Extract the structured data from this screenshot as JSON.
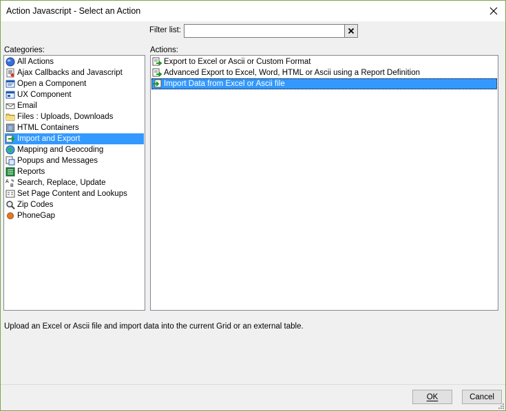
{
  "window": {
    "title": "Action Javascript - Select an Action",
    "close_icon": "close-icon"
  },
  "filter": {
    "label": "Filter list:",
    "value": "",
    "clear_icon": "clear-x-icon"
  },
  "categories": {
    "label": "Categories:",
    "selected_index": 7,
    "items": [
      {
        "label": "All Actions",
        "icon": "globe-blue-icon"
      },
      {
        "label": "Ajax Callbacks and Javascript",
        "icon": "script-icon"
      },
      {
        "label": "Open a Component",
        "icon": "component-window-icon"
      },
      {
        "label": "UX Component",
        "icon": "ux-window-icon"
      },
      {
        "label": "Email",
        "icon": "email-icon"
      },
      {
        "label": "Files : Uploads, Downloads",
        "icon": "folder-icon"
      },
      {
        "label": "HTML Containers",
        "icon": "html-container-icon"
      },
      {
        "label": "Import and Export",
        "icon": "import-export-icon"
      },
      {
        "label": "Mapping and Geocoding",
        "icon": "earth-icon"
      },
      {
        "label": "Popups and Messages",
        "icon": "popup-icon"
      },
      {
        "label": "Reports",
        "icon": "report-icon"
      },
      {
        "label": "Search, Replace, Update",
        "icon": "search-replace-icon"
      },
      {
        "label": "Set Page Content and Lookups",
        "icon": "page-content-icon"
      },
      {
        "label": "Zip Codes",
        "icon": "magnifier-icon"
      },
      {
        "label": "PhoneGap",
        "icon": "phonegap-icon"
      }
    ]
  },
  "actions": {
    "label": "Actions:",
    "selected_index": 2,
    "items": [
      {
        "label": "Export to Excel or Ascii or Custom Format",
        "icon": "export-icon"
      },
      {
        "label": "Advanced Export to Excel, Word, HTML or Ascii using a Report Definition",
        "icon": "export-icon"
      },
      {
        "label": "Import Data from Excel or Ascii file",
        "icon": "import-icon"
      }
    ]
  },
  "description": "Upload an Excel or Ascii file and import data into the current Grid or an external table.",
  "buttons": {
    "ok": "OK",
    "cancel": "Cancel"
  }
}
